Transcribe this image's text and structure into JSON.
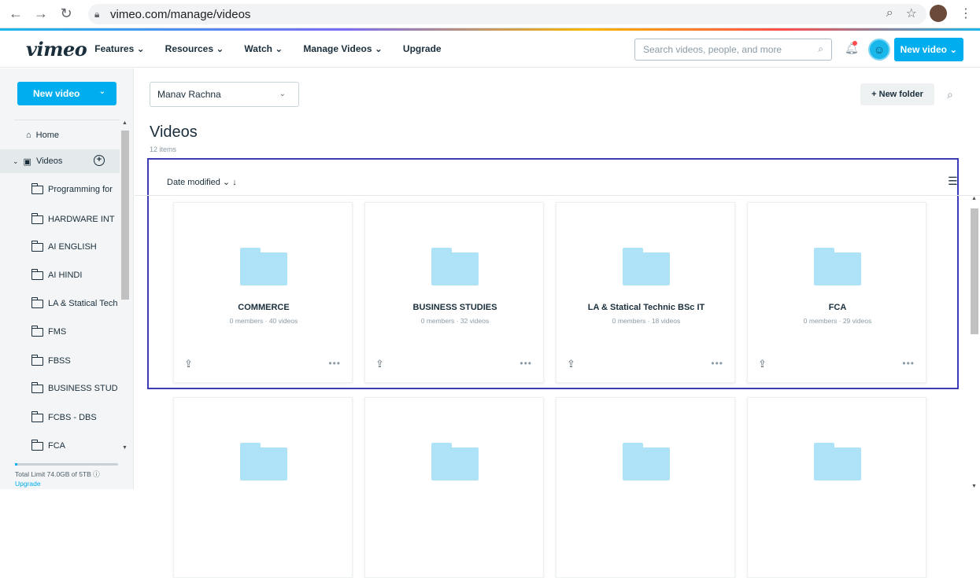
{
  "browser": {
    "url": "vimeo.com/manage/videos"
  },
  "topnav": {
    "logo": "vimeo",
    "menu": [
      {
        "label": "Features ⌄"
      },
      {
        "label": "Resources ⌄"
      },
      {
        "label": "Watch ⌄"
      },
      {
        "label": "Manage Videos ⌄"
      },
      {
        "label": "Upgrade"
      }
    ],
    "search_placeholder": "Search videos, people, and more",
    "new_video": "New video ⌄"
  },
  "sidebar": {
    "new_video": "New video",
    "home": "Home",
    "videos": "Videos",
    "folders": [
      "Programming for",
      "HARDWARE INT",
      "AI ENGLISH",
      "AI HINDI",
      "LA & Statical Tech",
      "FMS",
      "FBSS",
      "BUSINESS STUD",
      "FCBS - DBS",
      "FCA"
    ],
    "storage": {
      "text": "Total Limit   74.0GB of 5TB ⓘ",
      "used_fraction": 0.0148
    },
    "upgrade": "Upgrade"
  },
  "main": {
    "team": "Manav Rachna",
    "new_folder": "+ New folder",
    "title": "Videos",
    "count": "12 items",
    "sort": "Date modified ⌄  ↓",
    "cards": [
      {
        "title": "COMMERCE",
        "meta": "0 members · 40 videos"
      },
      {
        "title": "BUSINESS STUDIES",
        "meta": "0 members · 32 videos"
      },
      {
        "title": "LA & Statical Technic BSc IT",
        "meta": "0 members · 18 videos"
      },
      {
        "title": "FCA",
        "meta": "0 members · 29 videos"
      }
    ]
  },
  "colors": {
    "accent": "#00adef",
    "highlight_border": "#3b3cb8",
    "folder_fill": "#aee3f7"
  }
}
